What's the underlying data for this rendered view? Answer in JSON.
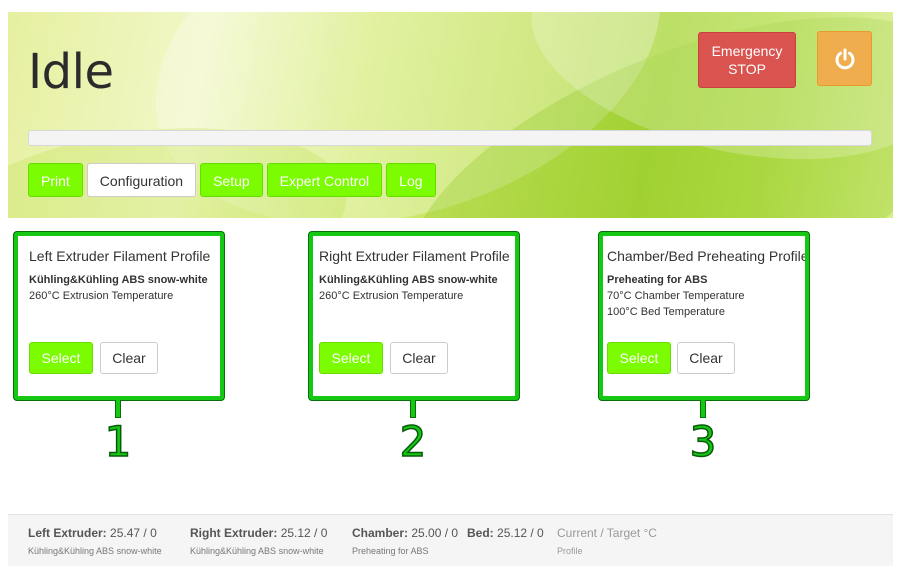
{
  "header": {
    "status": "Idle",
    "emergency_line1": "Emergency",
    "emergency_line2": "STOP",
    "power_icon": "power-icon",
    "progress_percent": 0
  },
  "tabs": [
    {
      "label": "Print",
      "active": false
    },
    {
      "label": "Configuration",
      "active": true
    },
    {
      "label": "Setup",
      "active": false
    },
    {
      "label": "Expert Control",
      "active": false
    },
    {
      "label": "Log",
      "active": false
    }
  ],
  "panels": [
    {
      "title": "Left Extruder Filament Profile",
      "profile": "Kühling&Kühling ABS snow-white",
      "lines": [
        "260°C Extrusion Temperature"
      ],
      "select_label": "Select",
      "clear_label": "Clear",
      "callout": "1"
    },
    {
      "title": "Right Extruder Filament Profile",
      "profile": "Kühling&Kühling ABS snow-white",
      "lines": [
        "260°C Extrusion Temperature"
      ],
      "select_label": "Select",
      "clear_label": "Clear",
      "callout": "2"
    },
    {
      "title": "Chamber/Bed Preheating Profile",
      "profile": "Preheating for ABS",
      "lines": [
        "70°C Chamber Temperature",
        "100°C Bed Temperature"
      ],
      "select_label": "Select",
      "clear_label": "Clear",
      "callout": "3"
    }
  ],
  "footer": {
    "temps": [
      {
        "label": "Left Extruder:",
        "value": "25.47 / 0",
        "profile": "Kühling&Kühling ABS snow-white"
      },
      {
        "label": "Right Extruder:",
        "value": "25.12 / 0",
        "profile": "Kühling&Kühling ABS snow-white"
      },
      {
        "label": "Chamber:",
        "value": "25.00 / 0",
        "profile": "Preheating for ABS"
      },
      {
        "label": "Bed:",
        "value": "25.12 / 0",
        "profile": ""
      }
    ],
    "legend_line1": "Current / Target °C",
    "legend_line2": "Profile"
  },
  "colors": {
    "accent_green": "#7cfc00",
    "callout_green": "#14c814",
    "emergency_red": "#d9534f",
    "power_orange": "#f0ad4e"
  }
}
